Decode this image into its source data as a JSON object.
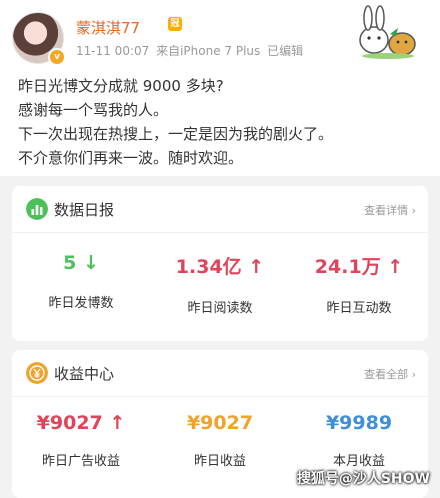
{
  "user": {
    "name": "蒙淇淇77",
    "crown_symbol": "冠",
    "verified_symbol": "v"
  },
  "post": {
    "date": "11-11 00:07",
    "source": "来自iPhone 7 Plus",
    "edited": "已编辑",
    "lines": [
      "昨日光博文分成就 9000 多块?",
      "感谢每一个骂我的人。",
      "下一次出现在热搜上，一定是因为我的剧火了。",
      "不介意你们再来一波。随时欢迎。"
    ]
  },
  "data_report": {
    "title": "数据日报",
    "link": "查看详情 ›",
    "icon": "bar-chart-icon",
    "stats": [
      {
        "value": "5",
        "arrow": "↓",
        "label": "昨日发博数",
        "color": "#4cc15a"
      },
      {
        "value": "1.34亿",
        "arrow": "↑",
        "label": "昨日阅读数",
        "color": "#e0445a"
      },
      {
        "value": "24.1万",
        "arrow": "↑",
        "label": "昨日互动数",
        "color": "#e0445a"
      }
    ]
  },
  "income": {
    "title": "收益中心",
    "link": "查看全部 ›",
    "icon": "yuan-coin-icon",
    "stats": [
      {
        "value": "¥9027",
        "arrow": "↑",
        "label": "昨日广告收益",
        "color": "#e0445a"
      },
      {
        "value": "¥9027",
        "arrow": "",
        "label": "昨日收益",
        "color": "#f1a22a"
      },
      {
        "value": "¥9989",
        "arrow": "",
        "label": "本月收益",
        "color": "#3d8fd9"
      }
    ]
  },
  "watermark": "搜狐号@沙人SHOW",
  "colors": {
    "username": "#e8671f",
    "green": "#4cc15a",
    "red": "#e0445a",
    "orange": "#f1a22a",
    "blue": "#3d8fd9"
  }
}
